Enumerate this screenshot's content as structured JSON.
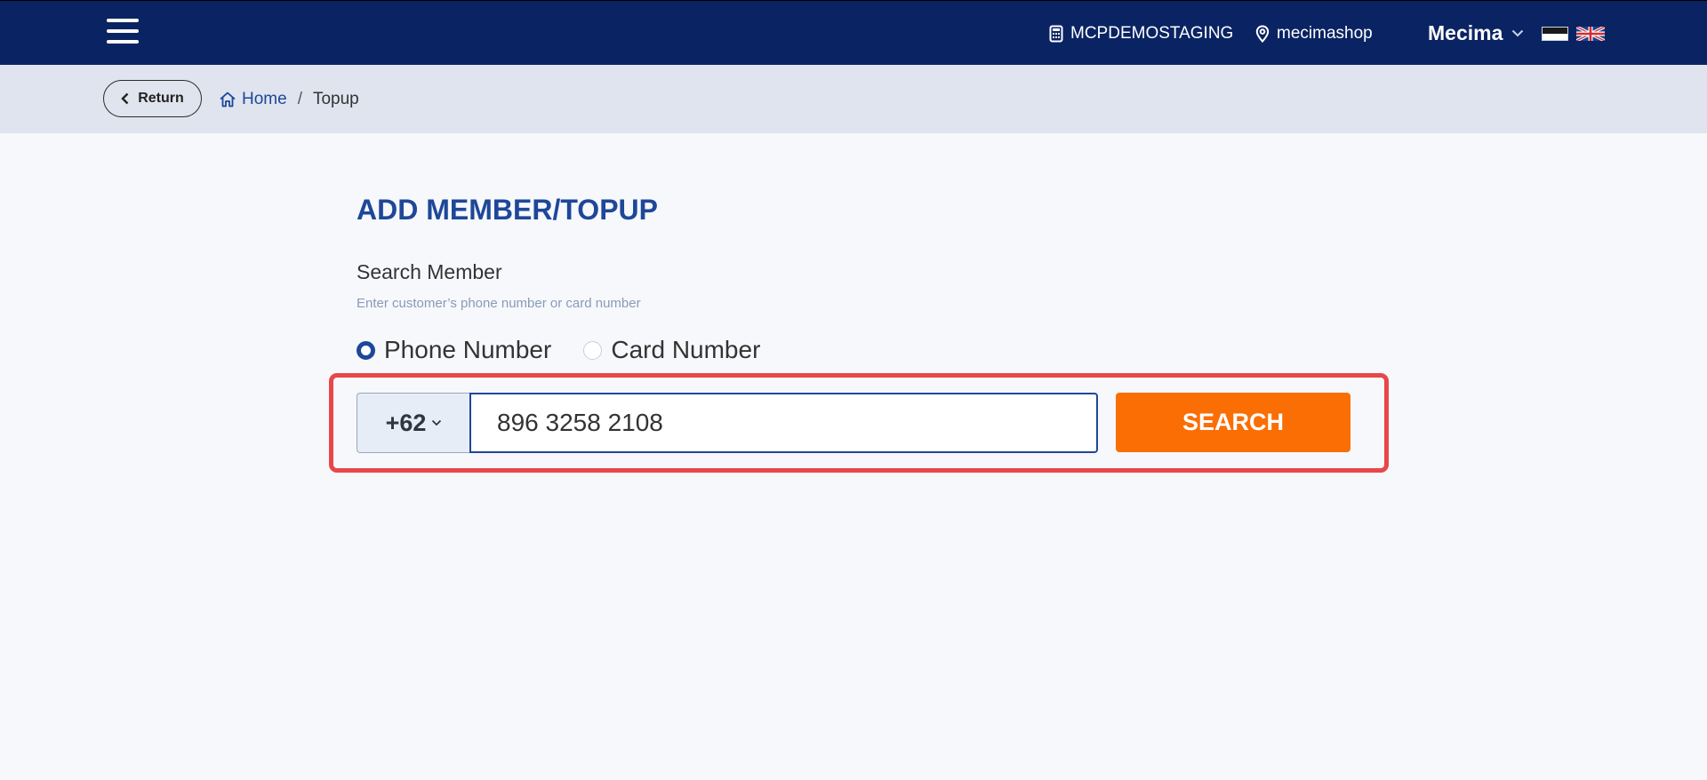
{
  "header": {
    "store_code": "MCPDEMOSTAGING",
    "location": "mecimashop",
    "user": "Mecima"
  },
  "breadcrumb": {
    "return_label": "Return",
    "home": "Home",
    "current": "Topup"
  },
  "form": {
    "title": "ADD MEMBER/TOPUP",
    "search_label": "Search Member",
    "hint": "Enter customer’s phone number or card number",
    "radio_phone": "Phone Number",
    "radio_card": "Card Number",
    "selected_mode": "Phone Number",
    "country_code": "+62",
    "phone_value": "896 3258 2108",
    "search_label_button": "SEARCH"
  },
  "colors": {
    "navbar": "#0a2463",
    "accent": "#1e4799",
    "search_button": "#fb6e04",
    "highlight": "#e8474a"
  }
}
